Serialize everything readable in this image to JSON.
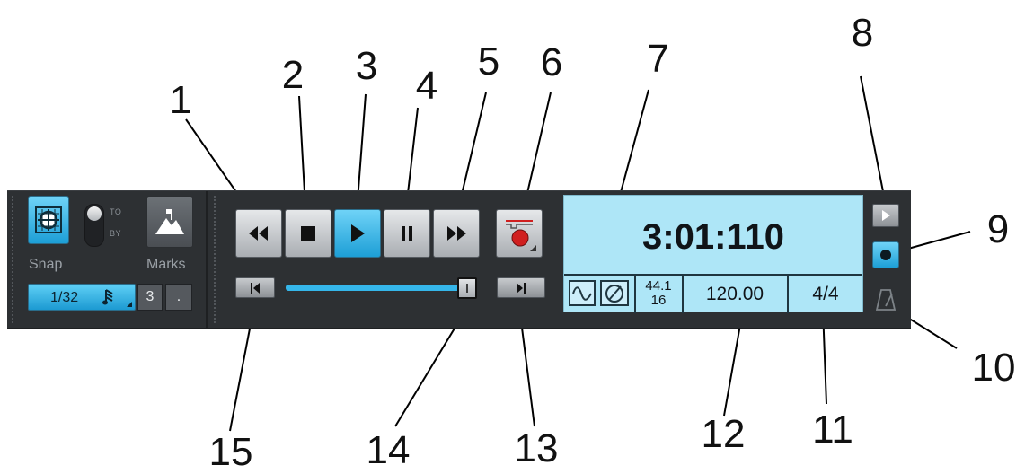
{
  "snap": {
    "snap_label": "Snap",
    "marks_label": "Marks",
    "to_label": "TO",
    "by_label": "BY",
    "resolution": "1/32",
    "triplet_value": "3",
    "dot_value": "."
  },
  "transport": {
    "buttons": [
      "rewind",
      "stop",
      "play",
      "pause",
      "fast-forward",
      "record-options"
    ]
  },
  "display": {
    "time": "3:01:110",
    "sample_rate": "44.1",
    "bit_depth": "16",
    "tempo": "120.00",
    "meter": "4/4"
  },
  "position_slider": {
    "value": 0.95
  },
  "callouts": [
    "1",
    "2",
    "3",
    "4",
    "5",
    "6",
    "7",
    "8",
    "9",
    "10",
    "11",
    "12",
    "13",
    "14",
    "15"
  ],
  "colors": {
    "accent": "#1d9fd6",
    "display_bg": "#aee6f7",
    "panel_bg": "#2d3033",
    "record_red": "#d01f1f"
  }
}
